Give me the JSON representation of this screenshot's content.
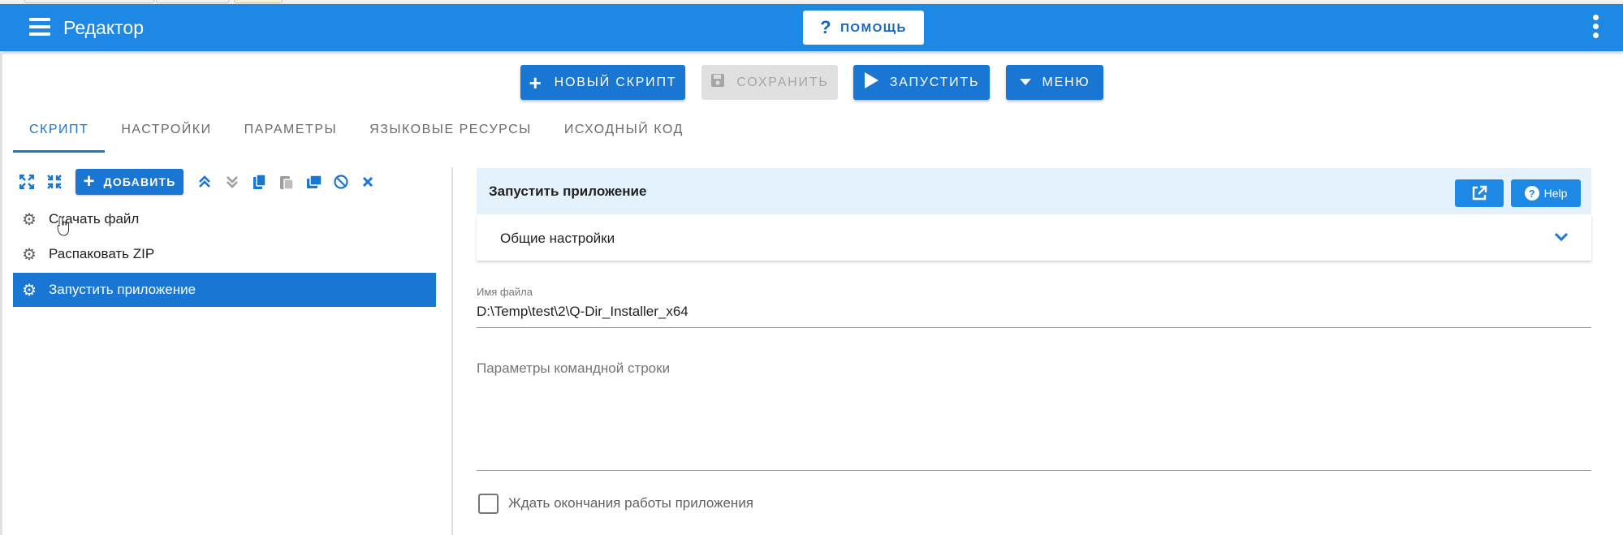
{
  "app": {
    "title": "Редактор",
    "help_label": "ПОМОЩЬ"
  },
  "actions": {
    "new_script": "НОВЫЙ СКРИПТ",
    "save": "СОХРАНИТЬ",
    "run": "ЗАПУСТИТЬ",
    "menu": "МЕНЮ"
  },
  "tabs": [
    {
      "label": "СКРИПТ",
      "active": true
    },
    {
      "label": "НАСТРОЙКИ",
      "active": false
    },
    {
      "label": "ПАРАМЕТРЫ",
      "active": false
    },
    {
      "label": "ЯЗЫКОВЫЕ РЕСУРСЫ",
      "active": false
    },
    {
      "label": "ИСХОДНЫЙ КОД",
      "active": false
    }
  ],
  "toolbar": {
    "add_label": "ДОБАВИТЬ"
  },
  "steps": [
    {
      "label": "Скачать файл",
      "active": false
    },
    {
      "label": "Распаковать ZIP",
      "active": false
    },
    {
      "label": "Запустить приложение",
      "active": true
    }
  ],
  "detail": {
    "title": "Запустить приложение",
    "help_label": "Help",
    "section_label": "Общие настройки",
    "file_label": "Имя файла",
    "file_value": "D:\\Temp\\test\\2\\Q-Dir_Installer_x64",
    "params_placeholder": "Параметры командной строки",
    "wait_label": "Ждать окончания работы приложения",
    "wait_checked": false
  },
  "colors": {
    "primary": "#1e88e5",
    "accent": "#1976d2",
    "header_bg": "#e3f2fd"
  }
}
